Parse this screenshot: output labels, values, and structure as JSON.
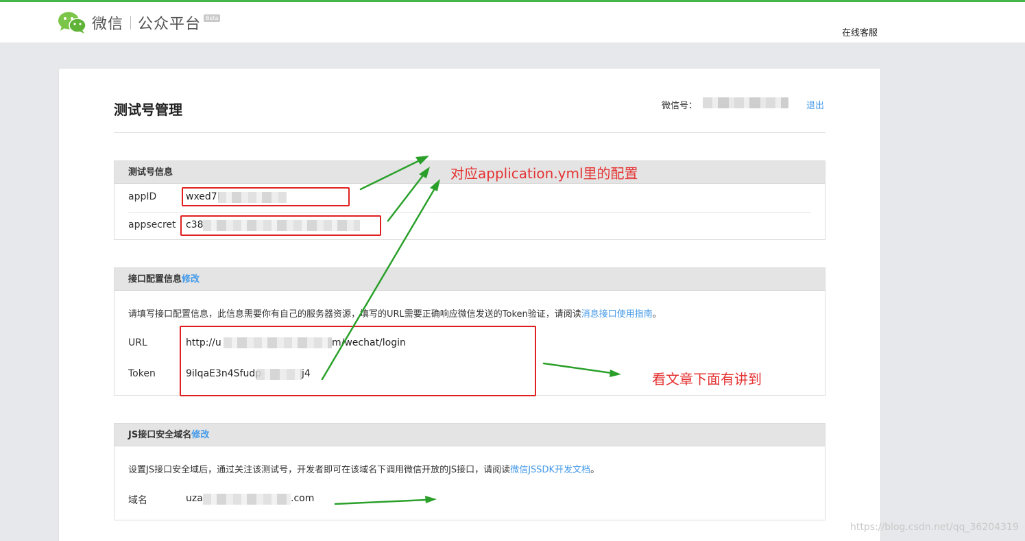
{
  "header": {
    "logo_wx": "微信",
    "logo_mp": "公众平台",
    "logo_beta": "Beta",
    "service_link": "在线客服"
  },
  "page": {
    "title": "测试号管理",
    "account_label": "微信号：",
    "logout": "退出"
  },
  "test_account": {
    "title": "测试号信息",
    "appid_label": "appID",
    "appid_value": "wxed7l",
    "appsecret_label": "appsecret",
    "appsecret_value": "c38"
  },
  "interface_config": {
    "title": "接口配置信息",
    "edit": "修改",
    "desc": "请填写接口配置信息，此信息需要你有自己的服务器资源，填写的URL需要正确响应微信发送的Token验证，请阅读",
    "desc_link": "消息接口使用指南",
    "desc_end": "。",
    "url_label": "URL",
    "url_prefix": "http://u",
    "url_suffix": "m/wechat/login",
    "token_label": "Token",
    "token_prefix": "9ilqaE3n4Sfudp",
    "token_suffix": "j4"
  },
  "js_domain": {
    "title": "JS接口安全域名",
    "edit": "修改",
    "desc": "设置JS接口安全域后，通过关注该测试号，开发者即可在该域名下调用微信开放的JS接口，请阅读",
    "desc_link": "微信JSSDK开发文档",
    "desc_end": "。",
    "domain_label": "域名",
    "domain_prefix": "uza",
    "domain_suffix": ".com"
  },
  "annotations": {
    "config_note": "对应application.yml里的配置",
    "article_note": "看文章下面有讲到"
  },
  "watermark": "https://blog.csdn.net/qq_36204319",
  "colors": {
    "brand_green": "#44b549",
    "link_blue": "#459ae9",
    "annotation_red": "#e53333",
    "arrow_green": "#2aa02a"
  }
}
